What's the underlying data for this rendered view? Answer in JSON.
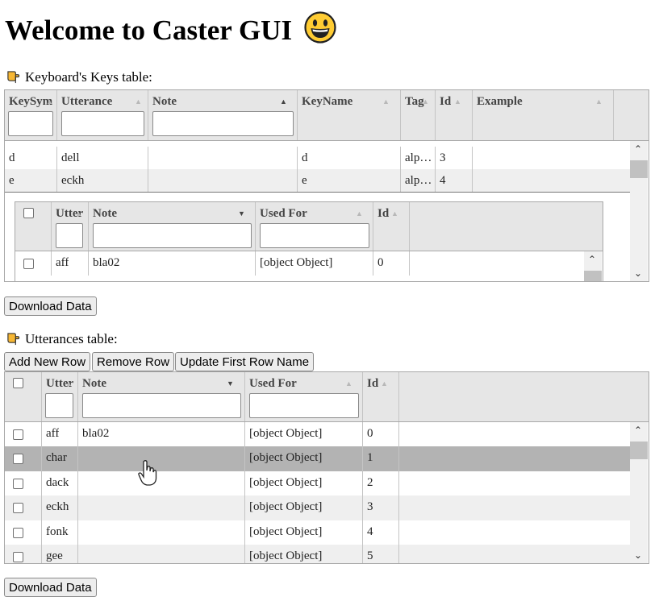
{
  "page": {
    "title": "Welcome to Caster GUI",
    "title_emoji": "smiley-face-icon"
  },
  "keys_section": {
    "label": "Keyboard's Keys table:",
    "icon": "pointing-hand-icon",
    "columns": [
      "KeySym",
      "Utterance",
      "Note",
      "KeyName",
      "Tag",
      "Id",
      "Example"
    ],
    "rows": [
      {
        "keysym": "d",
        "utterance": "dell",
        "note": "",
        "keyname": "d",
        "tag": "alp…",
        "id": "3",
        "example": ""
      },
      {
        "keysym": "e",
        "utterance": "eckh",
        "note": "",
        "keyname": "e",
        "tag": "alp…",
        "id": "4",
        "example": ""
      }
    ],
    "nested": {
      "columns": [
        "Utter",
        "Note",
        "Used For",
        "Id"
      ],
      "rows": [
        {
          "utter": "aff",
          "note": "bla02",
          "used_for": "[object Object]",
          "id": "0"
        }
      ]
    },
    "download_label": "Download Data"
  },
  "utterances_section": {
    "label": "Utterances table:",
    "icon": "pointing-hand-icon",
    "buttons": {
      "add": "Add New Row",
      "remove": "Remove Row",
      "update": "Update First Row Name"
    },
    "columns": [
      "Utter",
      "Note",
      "Used For",
      "Id"
    ],
    "rows": [
      {
        "utter": "aff",
        "note": "bla02",
        "used_for": "[object Object]",
        "id": "0"
      },
      {
        "utter": "char",
        "note": "",
        "used_for": "[object Object]",
        "id": "1"
      },
      {
        "utter": "dack",
        "note": "",
        "used_for": "[object Object]",
        "id": "2"
      },
      {
        "utter": "eckh",
        "note": "",
        "used_for": "[object Object]",
        "id": "3"
      },
      {
        "utter": "fonk",
        "note": "",
        "used_for": "[object Object]",
        "id": "4"
      },
      {
        "utter": "gee",
        "note": "",
        "used_for": "[object Object]",
        "id": "5"
      }
    ],
    "selected_row_index": 1,
    "download_label": "Download Data"
  },
  "colors": {
    "header_bg": "#e6e6e6",
    "row_alt": "#efefef",
    "row_selected": "#b3b3b3",
    "border": "#a8a8a8"
  }
}
